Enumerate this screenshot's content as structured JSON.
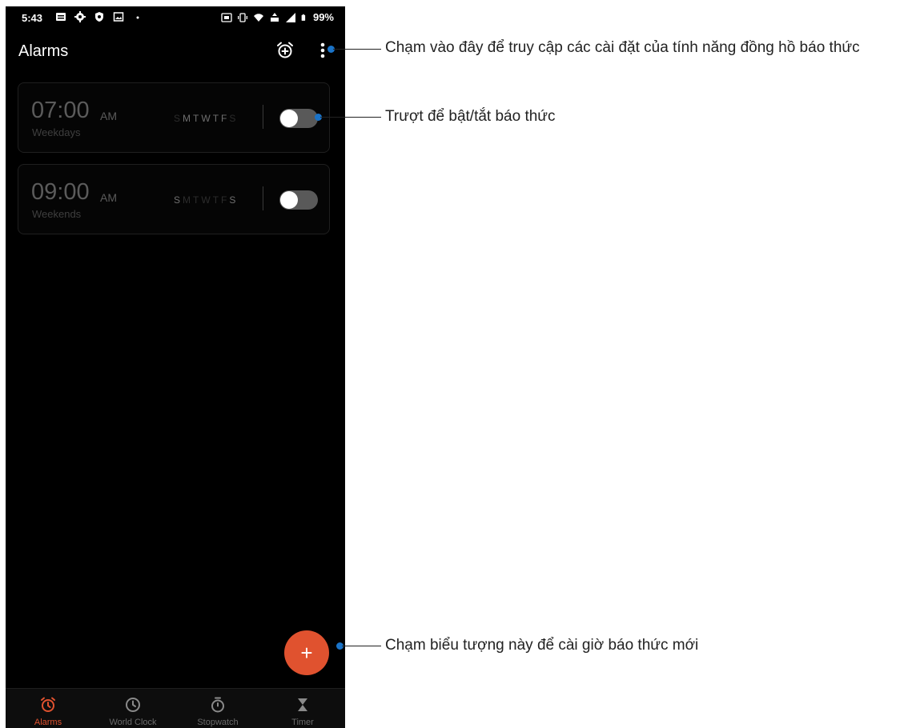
{
  "status_bar": {
    "time": "5:43",
    "battery": "99%"
  },
  "app_bar": {
    "title": "Alarms",
    "icons": [
      "add-alarm-icon",
      "more-vert-icon"
    ]
  },
  "alarms": [
    {
      "time": "07:00",
      "ampm": "AM",
      "label": "Weekdays",
      "days": [
        "S",
        "M",
        "T",
        "W",
        "T",
        "F",
        "S"
      ],
      "active_days": [
        false,
        true,
        true,
        true,
        true,
        true,
        false
      ],
      "enabled": false
    },
    {
      "time": "09:00",
      "ampm": "AM",
      "label": "Weekends",
      "days": [
        "S",
        "M",
        "T",
        "W",
        "T",
        "F",
        "S"
      ],
      "active_days": [
        true,
        false,
        false,
        false,
        false,
        false,
        true
      ],
      "enabled": false
    }
  ],
  "fab": {
    "label": "+"
  },
  "bottom_nav": {
    "items": [
      {
        "label": "Alarms",
        "icon": "alarm-clock-icon",
        "active": true
      },
      {
        "label": "World Clock",
        "icon": "clock-icon",
        "active": false
      },
      {
        "label": "Stopwatch",
        "icon": "stopwatch-icon",
        "active": false
      },
      {
        "label": "Timer",
        "icon": "hourglass-icon",
        "active": false
      }
    ]
  },
  "annotations": {
    "settings": "Chạm vào đây để truy cập các cài đặt của tính năng đồng hồ báo thức",
    "toggle": "Trượt để bật/tắt báo thức",
    "fab": "Chạm biểu tượng này để cài giờ báo thức mới"
  },
  "colors": {
    "accent": "#e0522f",
    "background": "#000000",
    "callout_dot": "#1a73c8"
  }
}
